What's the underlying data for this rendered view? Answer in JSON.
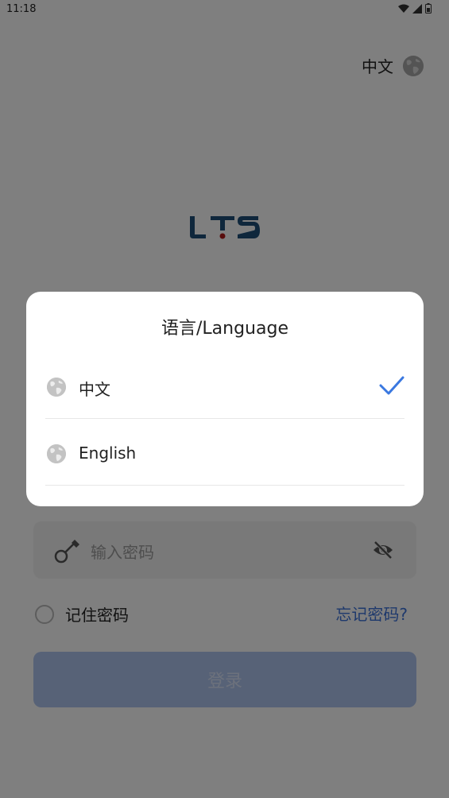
{
  "status_bar": {
    "time": "11:18",
    "icons": [
      "wifi-icon",
      "signal-icon",
      "battery-icon"
    ]
  },
  "top_language": {
    "label": "中文",
    "icon": "globe-icon"
  },
  "logo": {
    "text": "LTS",
    "colors": {
      "primary": "#1f4e79",
      "accent": "#b01818"
    }
  },
  "password_field": {
    "placeholder": "输入密码",
    "leading_icon": "key-icon",
    "trailing_icon": "eye-off-icon"
  },
  "remember": {
    "label": "记住密码",
    "checked": false
  },
  "forgot_password": {
    "label": "忘记密码?"
  },
  "login_button": {
    "label": "登录"
  },
  "language_dialog": {
    "title": "语言/Language",
    "options": [
      {
        "label": "中文",
        "selected": true
      },
      {
        "label": "English",
        "selected": false
      }
    ],
    "accent_color": "#3a78e0"
  }
}
